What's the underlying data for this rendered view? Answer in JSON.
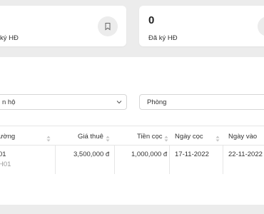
{
  "stats": {
    "left": {
      "label": "ký HĐ",
      "icon": "bookmark-icon"
    },
    "right": {
      "value": "0",
      "label": "Đã ký HĐ",
      "icon": "bookmark-icon"
    }
  },
  "filters": {
    "left_select": {
      "value": "n hộ"
    },
    "right_select": {
      "value": "Phòng"
    }
  },
  "table": {
    "headers": [
      "ường",
      "Giá thuê",
      "Tiền cọc",
      "Ngày cọc",
      "Ngày vào"
    ],
    "rows": [
      {
        "col0": "01",
        "col0_sub": "H01",
        "price": "3,500,000 đ",
        "deposit": "1,000,000 đ",
        "deposit_date": "17-11-2022",
        "move_in_date": "22-11-2022"
      }
    ]
  },
  "colors": {
    "background": "#ececec",
    "card": "#ffffff",
    "border": "#e6e6e6"
  }
}
